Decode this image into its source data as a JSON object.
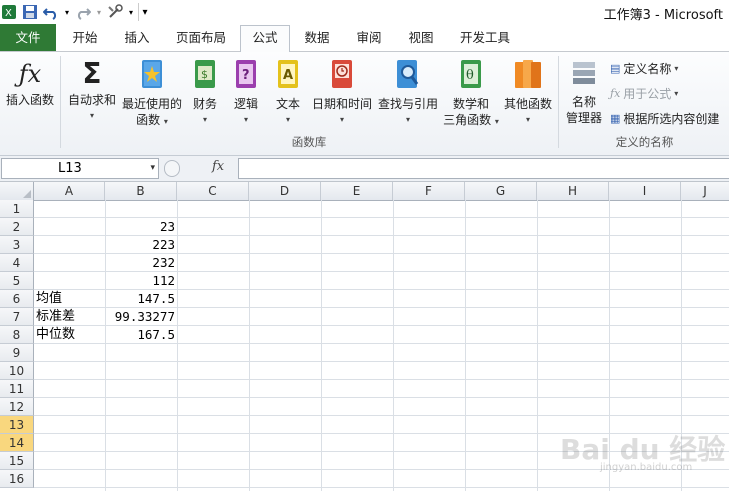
{
  "titlebar": {
    "doc_title": "工作簿3 - Microsoft"
  },
  "tabs": [
    {
      "label": "文件"
    },
    {
      "label": "开始"
    },
    {
      "label": "插入"
    },
    {
      "label": "页面布局"
    },
    {
      "label": "公式"
    },
    {
      "label": "数据"
    },
    {
      "label": "审阅"
    },
    {
      "label": "视图"
    },
    {
      "label": "开发工具"
    }
  ],
  "ribbon": {
    "insert_function": "插入函数",
    "autosum": "自动求和",
    "recent_1": "最近使用的",
    "recent_2": "函数",
    "financial": "财务",
    "logical": "逻辑",
    "text": "文本",
    "datetime": "日期和时间",
    "lookup": "查找与引用",
    "math_1": "数学和",
    "math_2": "三角函数",
    "other": "其他函数",
    "name_mgr_1": "名称",
    "name_mgr_2": "管理器",
    "define_name": "定义名称",
    "use_in_formula": "用于公式",
    "create_from_sel": "根据所选内容创建",
    "group_funclib": "函数库",
    "group_names": "定义的名称"
  },
  "formula_bar": {
    "name_box": "L13",
    "fx": "fx",
    "formula": ""
  },
  "columns": [
    "A",
    "B",
    "C",
    "D",
    "E",
    "F",
    "G",
    "H",
    "I",
    "J"
  ],
  "rows": [
    {
      "n": "1",
      "a": "",
      "b": ""
    },
    {
      "n": "2",
      "a": "",
      "b": "23"
    },
    {
      "n": "3",
      "a": "",
      "b": "223"
    },
    {
      "n": "4",
      "a": "",
      "b": "232"
    },
    {
      "n": "5",
      "a": "",
      "b": "112"
    },
    {
      "n": "6",
      "a": "均值",
      "b": "147.5"
    },
    {
      "n": "7",
      "a": "标准差",
      "b": "99.33277"
    },
    {
      "n": "8",
      "a": "中位数",
      "b": "167.5"
    },
    {
      "n": "9",
      "a": "",
      "b": ""
    },
    {
      "n": "10",
      "a": "",
      "b": ""
    },
    {
      "n": "11",
      "a": "",
      "b": ""
    },
    {
      "n": "12",
      "a": "",
      "b": ""
    },
    {
      "n": "13",
      "a": "",
      "b": ""
    },
    {
      "n": "14",
      "a": "",
      "b": ""
    },
    {
      "n": "15",
      "a": "",
      "b": ""
    },
    {
      "n": "16",
      "a": "",
      "b": ""
    }
  ],
  "watermark": {
    "brand": "Bai du 经验",
    "url": "jingyan.baidu.com"
  }
}
